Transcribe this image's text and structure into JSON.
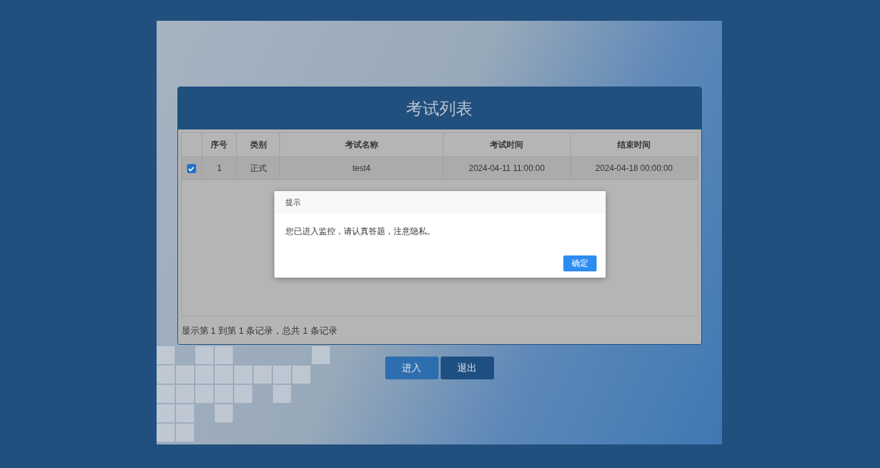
{
  "panel": {
    "title": "考试列表",
    "table": {
      "columns": [
        "序号",
        "类别",
        "考试名称",
        "考试时间",
        "结束时间"
      ],
      "rows": [
        {
          "checked": true,
          "cells": [
            "1",
            "正式",
            "test4",
            "2024-04-11 11:00:00",
            "2024-04-18 00:00:00"
          ]
        }
      ]
    },
    "footer": "显示第 1 到第 1 条记录，总共 1 条记录"
  },
  "buttons": [
    {
      "label": "进入",
      "kind": "primary"
    },
    {
      "label": "退出",
      "kind": "dark"
    }
  ],
  "dialog": {
    "title": "提示",
    "message": "您已进入监控，请认真答题，注意隐私。",
    "button": "确定"
  }
}
